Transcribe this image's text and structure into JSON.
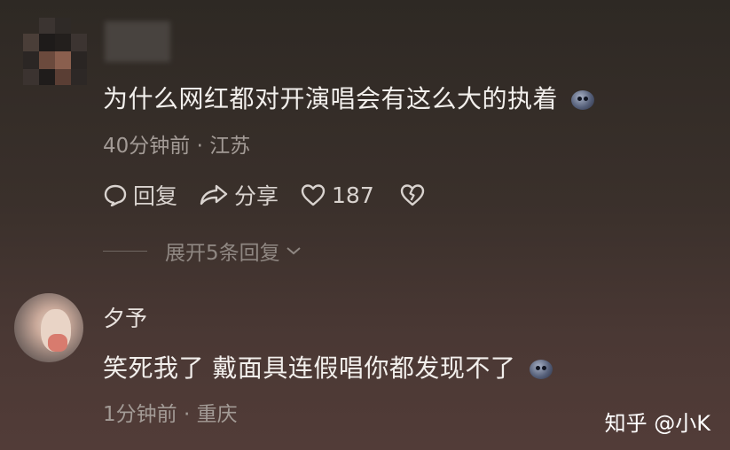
{
  "comment1": {
    "text": "为什么网红都对开演唱会有这么大的执着",
    "emoji_icon": "pale-face-emoji-icon",
    "meta": "40分钟前 · 江苏",
    "actions": {
      "reply": "回复",
      "share": "分享",
      "likes": "187"
    },
    "expand_replies": "展开5条回复"
  },
  "comment2": {
    "username": "夕予",
    "text": "笑死我了 戴面具连假唱你都发现不了",
    "emoji_icon": "pale-face-emoji-icon",
    "meta": "1分钟前 · 重庆"
  },
  "watermark": "知乎 @小K",
  "colors": {
    "background_top": "#2e2924",
    "background_bottom": "#523c38",
    "primary_text": "#f2efec",
    "meta_text": "#a39b96"
  }
}
